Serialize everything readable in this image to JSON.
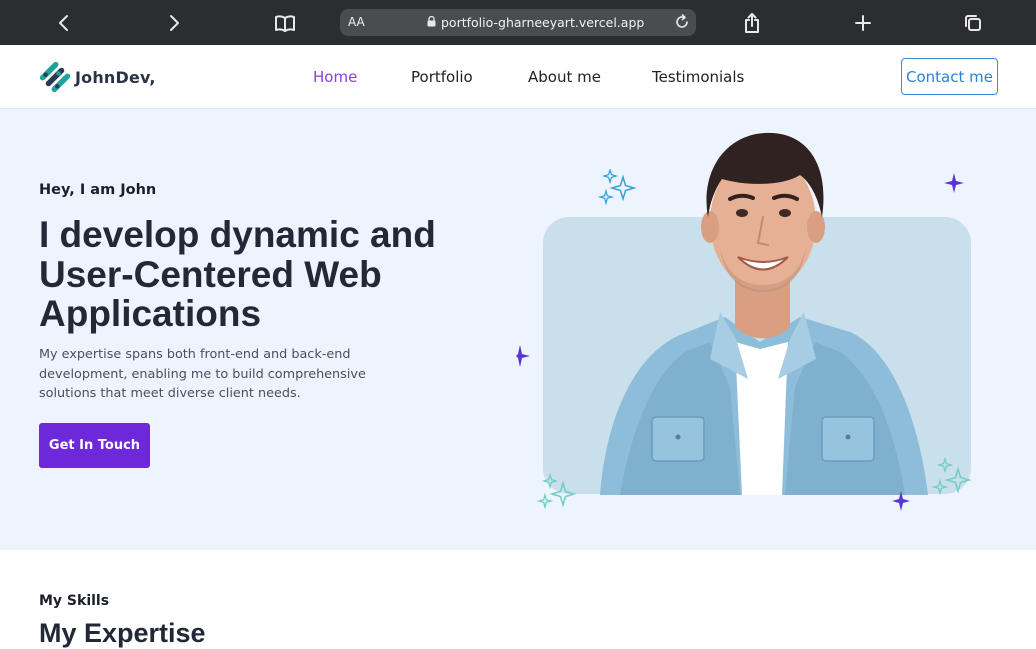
{
  "browser": {
    "text_size_label": "AA",
    "url": "portfolio-gharneeyart.vercel.app",
    "icons": [
      "back-icon",
      "forward-icon",
      "bookmarks-icon",
      "lock-icon",
      "reload-icon",
      "share-icon",
      "new-tab-icon",
      "tabs-icon"
    ]
  },
  "nav": {
    "brand": "JohnDev,",
    "links": [
      "Home",
      "Portfolio",
      "About me",
      "Testimonials"
    ],
    "active": "Home",
    "contact_label": "Contact me"
  },
  "hero": {
    "eyebrow": "Hey, I am John",
    "title": "I develop dynamic and User-Centered Web Applications",
    "description": "My expertise spans both front-end and back-end development, enabling me to build comprehensive solutions that meet diverse client needs.",
    "cta_label": "Get In Touch"
  },
  "skills": {
    "eyebrow": "My Skills",
    "title": "My Expertise"
  },
  "colors": {
    "accent_purple": "#6d28d9",
    "nav_active": "#8a3ee6",
    "contact_blue": "#2a7fe0",
    "hero_bg": "#eef4fd",
    "browser_bar": "#2b2d30"
  }
}
